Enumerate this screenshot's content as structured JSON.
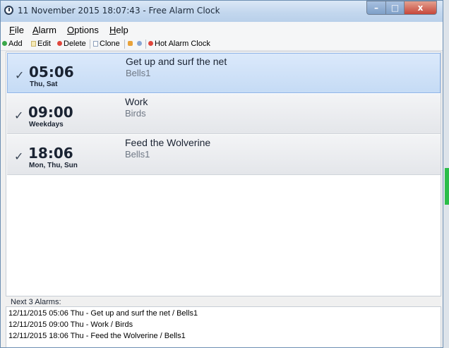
{
  "window": {
    "title": "11 November 2015 18:07:43 - Free Alarm Clock",
    "controls": {
      "minimize": "–",
      "maximize": "□",
      "close": "x"
    }
  },
  "menu": [
    {
      "label": "File",
      "underline": "F",
      "rest": "ile"
    },
    {
      "label": "Alarm",
      "underline": "A",
      "rest": "larm"
    },
    {
      "label": "Options",
      "underline": "O",
      "rest": "ptions"
    },
    {
      "label": "Help",
      "underline": "H",
      "rest": "elp"
    }
  ],
  "toolbar": {
    "add": "Add",
    "edit": "Edit",
    "delete": "Delete",
    "clone": "Clone",
    "hot_alarm": "Hot Alarm Clock"
  },
  "alarms": [
    {
      "enabled": true,
      "check": "✓",
      "time": "05:06",
      "days": "Thu, Sat",
      "label": "Get up and surf the net",
      "sound": "Bells1",
      "selected": true
    },
    {
      "enabled": true,
      "check": "✓",
      "time": "09:00",
      "days": "Weekdays",
      "label": "Work",
      "sound": "Birds",
      "selected": false
    },
    {
      "enabled": true,
      "check": "✓",
      "time": "18:06",
      "days": "Mon, Thu, Sun",
      "label": "Feed the Wolverine",
      "sound": "Bells1",
      "selected": false
    }
  ],
  "next_alarms": {
    "heading": "Next 3 Alarms:",
    "lines": [
      "12/11/2015 05:06 Thu - Get up and surf the net / Bells1",
      "12/11/2015 09:00 Thu - Work / Birds",
      "12/11/2015 18:06 Thu - Feed the Wolverine / Bells1"
    ]
  },
  "colors": {
    "selected_row": "#c5dbf5",
    "add_icon": "#3aa84a",
    "delete_icon": "#e0463c",
    "hot_icon": "#e0463c"
  }
}
